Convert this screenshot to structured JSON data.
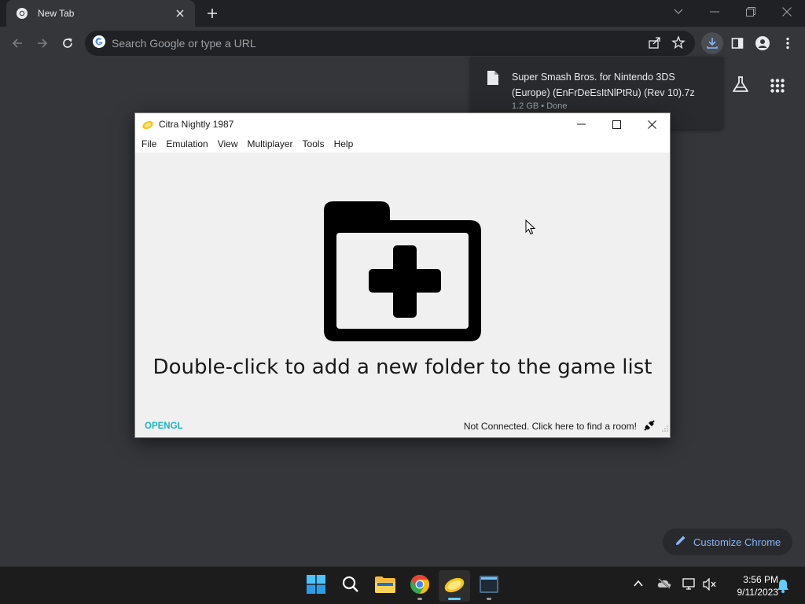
{
  "browser": {
    "tab": {
      "title": "New Tab"
    },
    "omnibox": {
      "placeholder": "Search Google or type a URL"
    },
    "download": {
      "filename": "Super Smash Bros. for Nintendo 3DS (Europe) (EnFrDeEsItNlPtRu) (Rev 10).7z",
      "status": "1.2 GB • Done"
    },
    "customize_label": "Customize Chrome"
  },
  "citra": {
    "title": "Citra Nightly 1987",
    "menu": [
      "File",
      "Emulation",
      "View",
      "Multiplayer",
      "Tools",
      "Help"
    ],
    "empty_message": "Double-click to add a new folder to the game list",
    "status": {
      "renderer": "OPENGL",
      "network": "Not Connected. Click here to find a room!"
    }
  },
  "taskbar": {
    "apps": [
      "start-icon",
      "search-icon",
      "file-explorer-icon",
      "chrome-icon",
      "citra-icon",
      "terminal-icon"
    ],
    "clock": {
      "time": "3:56 PM",
      "date": "9/11/2023"
    }
  },
  "colors": {
    "accent": "#8ab4f8",
    "renderer_text": "#1fb3c8",
    "taskbar_active": "#60cdff"
  }
}
